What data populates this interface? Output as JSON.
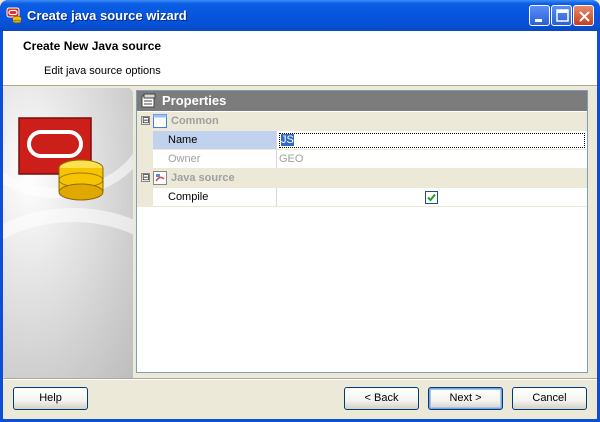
{
  "window": {
    "title": "Create java source wizard"
  },
  "header": {
    "title": "Create New Java source",
    "subtitle": "Edit java source options"
  },
  "properties": {
    "title": "Properties",
    "categories": [
      {
        "label": "Common",
        "expander": "⊟",
        "items": [
          {
            "name": "Name",
            "value": "JS",
            "state": "selected-editing"
          },
          {
            "name": "Owner",
            "value": "GEO",
            "state": "disabled"
          }
        ]
      },
      {
        "label": "Java source",
        "expander": "⊟",
        "items": [
          {
            "name": "Compile",
            "value": true,
            "state": "checkbox"
          }
        ]
      }
    ]
  },
  "footer": {
    "help_label": "Help",
    "back_label": "< Back",
    "next_label": "Next >",
    "cancel_label": "Cancel"
  },
  "colors": {
    "titlebar": "#0655de",
    "selection": "#c1d2ee",
    "category_bg": "#ece9d8",
    "properties_header": "#7c7c7c"
  }
}
